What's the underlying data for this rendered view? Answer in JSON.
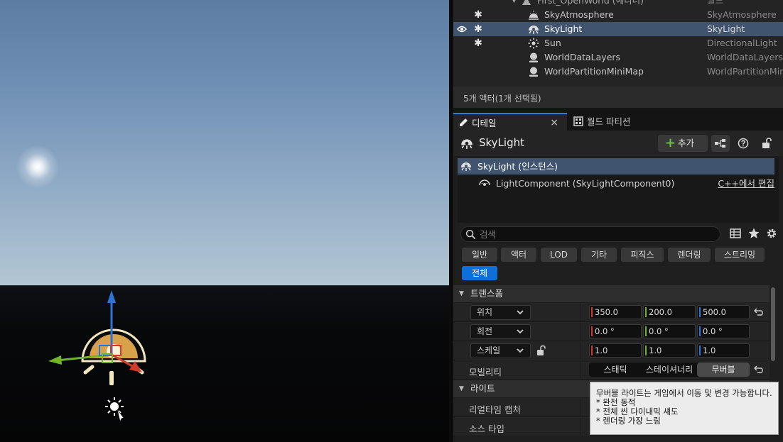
{
  "outliner": {
    "rows": [
      {
        "name": "First_OpenWorld (에디터)",
        "type": "월드"
      },
      {
        "name": "SkyAtmosphere",
        "type": "SkyAtmosphere"
      },
      {
        "name": "SkyLight",
        "type": "SkyLight"
      },
      {
        "name": "Sun",
        "type": "DirectionalLight"
      },
      {
        "name": "WorldDataLayers",
        "type": "WorldDataLayers"
      },
      {
        "name": "WorldPartitionMiniMap",
        "type": "WorldPartitionMiniMap"
      }
    ],
    "status": "5개 액터(1개 선택됨)"
  },
  "details": {
    "tabs": [
      {
        "label": "디테일",
        "icon": "pencil-icon"
      },
      {
        "label": "월드 파티션",
        "icon": "grid-icon"
      }
    ],
    "actor_name": "SkyLight",
    "add_label": "추가",
    "components": {
      "root": "SkyLight (인스턴스)",
      "child": "LightComponent (SkyLightComponent0)",
      "edit_cpp": "C++에서 편집"
    },
    "search_placeholder": "검색",
    "filters": [
      "일반",
      "액터",
      "LOD",
      "기타",
      "피직스",
      "렌더링",
      "스트리밍",
      "전체"
    ],
    "transform": {
      "category": "트랜스폼",
      "location": {
        "label": "위치",
        "x": "350.0",
        "y": "200.0",
        "z": "500.0"
      },
      "rotation": {
        "label": "회전",
        "x": "0.0 °",
        "y": "0.0 °",
        "z": "0.0 °"
      },
      "scale": {
        "label": "스케일",
        "x": "1.0",
        "y": "1.0",
        "z": "1.0"
      },
      "mobility": {
        "label": "모빌리티",
        "options": [
          "스태틱",
          "스테이셔너리",
          "무버블"
        ],
        "selected": "무버블"
      }
    },
    "light": {
      "category": "라이트",
      "realtime_capture": "리얼타임 캡처",
      "source_type": "소스 타입"
    }
  },
  "tooltip": {
    "lines": [
      "무버블 라이트는 게임에서 이동 및 변경 가능합니다.",
      "* 완전 동적",
      "* 전체 씬 다이내믹 섀도",
      "* 렌더링 가장 느림"
    ]
  },
  "colors": {
    "selection": "#40546f",
    "accent": "#0f6fd8",
    "add_plus": "#6fc04a",
    "axis_x": "#d23a2a",
    "axis_y": "#6fb32e",
    "axis_z": "#2e73d6"
  }
}
